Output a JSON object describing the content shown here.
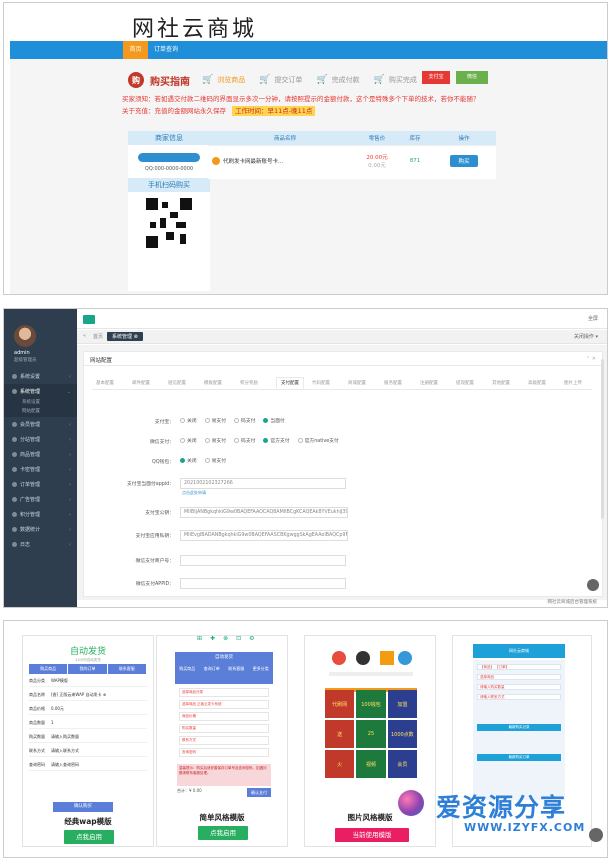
{
  "panel1": {
    "site_title": "网社云商城",
    "nav": {
      "home": "首页",
      "orders": "订单查询"
    },
    "guide": {
      "badge": "购",
      "title": "购买指南",
      "steps": [
        "浏览商品",
        "提交订单",
        "完成付款",
        "购买完成"
      ],
      "logo1": "支付宝",
      "logo2": "微信"
    },
    "notice1": "买家须知：若如遇交付款二维码的界面显示多次一分钟，请按照提示的金额付款，这个是特殊多个下单的技术，若你不能随？",
    "notice2": "关于充值：充值的金额网站永久保存",
    "hours": "工作时间：早11点-晚11点",
    "merchant": {
      "header": "商家信息",
      "qq": "QQ:000-0000-0000",
      "mobile_header": "手机扫码购买"
    },
    "products": {
      "headers": [
        "商品名称",
        "零售价",
        "库存",
        "操作"
      ],
      "rows": [
        {
          "name": "代刷发卡网最新账号卡...",
          "price": "20.00元",
          "price_sub": "0.00元",
          "stock": "871",
          "action": "购买"
        }
      ]
    }
  },
  "panel2": {
    "admin": {
      "name": "admin",
      "role": "超级管理员"
    },
    "menu": [
      {
        "label": "系统设置",
        "active": false
      },
      {
        "label": "系统管理",
        "active": true
      }
    ],
    "submenu": [
      "系统设置",
      "网站配置"
    ],
    "menu_rest": [
      "会员管理",
      "分站管理",
      "商品管理",
      "卡密管理",
      "订单管理",
      "广告管理",
      "积分管理",
      "数据统计",
      "日志"
    ],
    "topbar_right": "全屏",
    "tabs": {
      "back": "«",
      "home": "首页",
      "active": "系统管理 ⊗",
      "right": "关闭操作 ▾"
    },
    "card_title": "网站配置",
    "settings_tabs": [
      "基本配置",
      "邮件配置",
      "短信配置",
      "模板配置",
      "积分奖励",
      "支付配置",
      "代码配置",
      "商城配置",
      "服务配置",
      "注册配置",
      "提现配置",
      "其他配置",
      "高级配置",
      "图片上传"
    ],
    "form": {
      "row1": {
        "label": "支付宝：",
        "options": [
          "关闭",
          "易支付",
          "码支付",
          "当面付"
        ],
        "selected": 3
      },
      "row2": {
        "label": "微信支付：",
        "options": [
          "关闭",
          "易支付",
          "码支付",
          "官方支付",
          "官方native支付"
        ],
        "selected": 3
      },
      "row3": {
        "label": "QQ钱包：",
        "options": [
          "关闭",
          "易支付"
        ],
        "selected": 0
      },
      "row4": {
        "label": "支付宝当面付appid：",
        "value": "2021002102327266",
        "hint": "点击此处申请"
      },
      "row5": {
        "label": "支付宝公钥：",
        "value": "MIIBIjANBgkqhkiG9w0BAQEFAAOCAQ8AMIIBCgKCAQEAk8YVEukhiJ39N8Hmx"
      },
      "row6": {
        "label": "支付宝应用私钥：",
        "value": "MIIEvgIBADANBgkqhkiG9w0BAQEFAASCBKgwggSkAgEAAoIBAQCp9MgIQkD"
      },
      "row7": {
        "label": "微信支付商户号：",
        "value": ""
      },
      "row8": {
        "label": "微信支付APPID：",
        "value": ""
      }
    },
    "footnote": "网社云商城后台管理系统"
  },
  "panel3": {
    "toolbar_icons": [
      "⊞",
      "✚",
      "⊗",
      "⊡",
      "⚙"
    ],
    "templates": [
      {
        "name": "经典wap模版",
        "button": "点我启用"
      },
      {
        "name": "简单风格模版",
        "button": "点我启用"
      },
      {
        "name": "图片风格模版",
        "button": "当前使用模版"
      },
      {
        "name": "",
        "button": ""
      }
    ],
    "t1": {
      "heading": "自动发货",
      "sub": "24小时自动发货",
      "tabs": [
        "购买商品",
        "我的订单",
        "联系客服"
      ],
      "rows": [
        {
          "k": "商品分类",
          "v": "WAP模版"
        },
        {
          "k": "商品名称",
          "v": "[香] 正版云来WAP 自动发卡 ⊕"
        },
        {
          "k": "商品价格",
          "v": "0.00元"
        },
        {
          "k": "商品数量",
          "v": "1"
        },
        {
          "k": "购买数量",
          "v": "请输入购买数量"
        },
        {
          "k": "联系方式",
          "v": "请输入联系方式"
        },
        {
          "k": "查询密码",
          "v": "请输入查询密码"
        }
      ],
      "button": "确认购买"
    },
    "t2": {
      "header": "自动发货",
      "head_icons": [
        "购买商品",
        "查询订单",
        "联系客服",
        "更多分类"
      ],
      "fields": [
        "选择商品分类",
        "选择商品 正版云发卡系统",
        "商品价格",
        "购买数量",
        "联系方式",
        "查询密码"
      ],
      "notice": "温馨提示：购买后请妥善保存订单号及查询密码，如遇问题请联系客服处理。",
      "total": "合计：¥ 0.00",
      "pay": "确认支付"
    },
    "t3": {
      "tiles": [
        "代刷网",
        "100钱包",
        "加盟",
        "送",
        "25",
        "1000点数",
        "火",
        "视频",
        "会员"
      ]
    },
    "t4": {
      "header": "网社云商城",
      "lines": [
        "【商品】 【订单】",
        "选择商品",
        "请输入购买数量",
        "请输入联系方式"
      ],
      "sections": [
        "最新购买记录",
        "最新购买订单"
      ]
    },
    "watermark": {
      "text": "爱资源分享",
      "url": "WWW.IZYFX.COM"
    }
  }
}
